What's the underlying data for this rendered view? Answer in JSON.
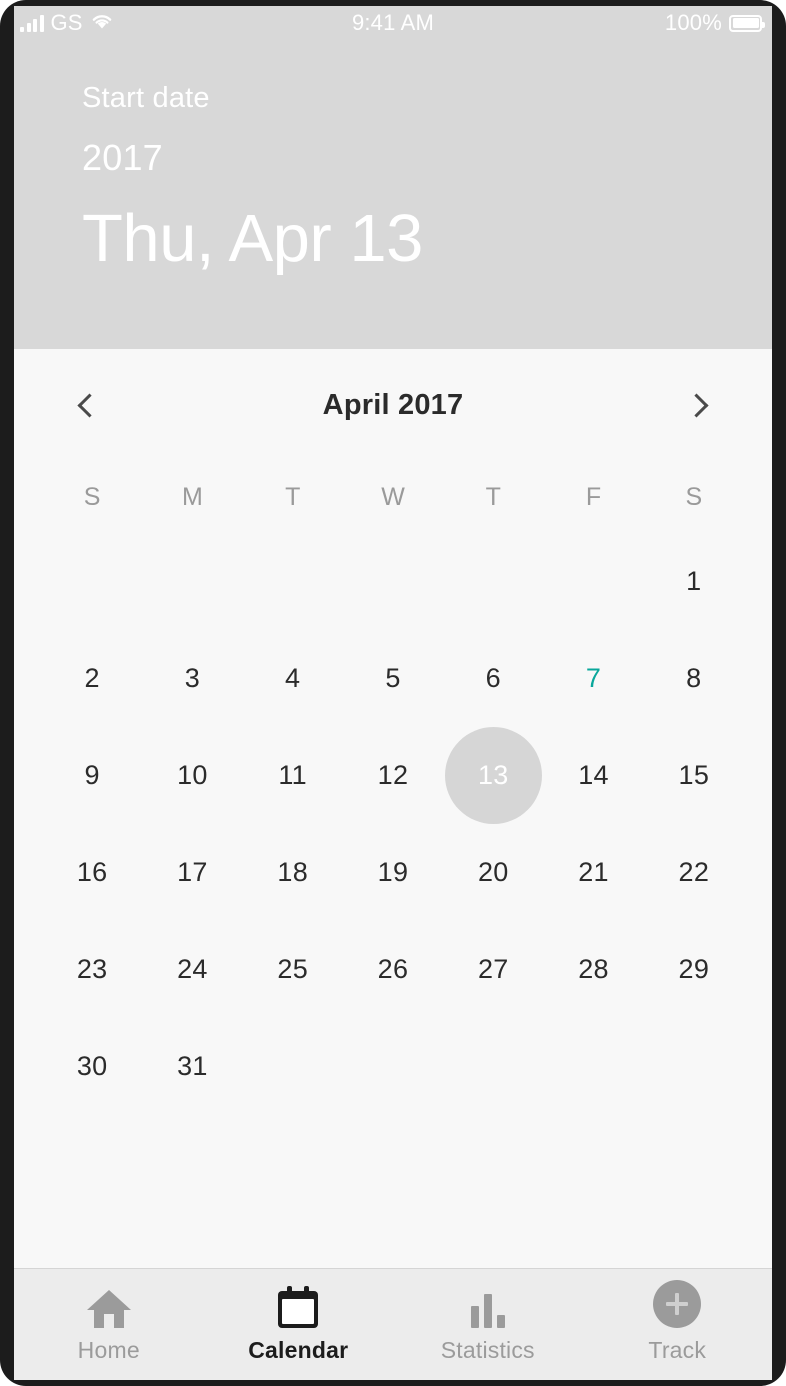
{
  "status_bar": {
    "carrier": "GS",
    "signal_icon": "signal-bars-icon",
    "wifi_icon": "wifi-icon",
    "time": "9:41 AM",
    "battery_percent": "100%",
    "battery_icon": "battery-full-icon"
  },
  "header": {
    "label": "Start date",
    "year": "2017",
    "date": "Thu, Apr 13",
    "background_color": "#d8d8d8",
    "text_color": "#ffffff"
  },
  "calendar": {
    "prev_icon": "chevron-left-icon",
    "next_icon": "chevron-right-icon",
    "month_title": "April 2017",
    "weekdays": [
      "S",
      "M",
      "T",
      "W",
      "T",
      "F",
      "S"
    ],
    "leading_blanks": 6,
    "days": [
      1,
      2,
      3,
      4,
      5,
      6,
      7,
      8,
      9,
      10,
      11,
      12,
      13,
      14,
      15,
      16,
      17,
      18,
      19,
      20,
      21,
      22,
      23,
      24,
      25,
      26,
      27,
      28,
      29,
      30,
      31
    ],
    "selected_day": 13,
    "today_day": 7,
    "accent_color": "#0aa79b",
    "selected_circle_color": "#d6d6d6",
    "selected_text_color": "#ffffff",
    "day_text_color": "#2b2b2b",
    "weekday_text_color": "#9a9a9a",
    "background_color": "#f8f8f8"
  },
  "tab_bar": {
    "items": [
      {
        "label": "Home",
        "icon": "home-icon",
        "active": false
      },
      {
        "label": "Calendar",
        "icon": "calendar-icon",
        "active": true
      },
      {
        "label": "Statistics",
        "icon": "bar-chart-icon",
        "active": false
      },
      {
        "label": "Track",
        "icon": "plus-circle-icon",
        "active": false
      }
    ],
    "background_color": "#ececec",
    "inactive_color": "#9b9b9b",
    "active_color": "#1c1c1c"
  }
}
